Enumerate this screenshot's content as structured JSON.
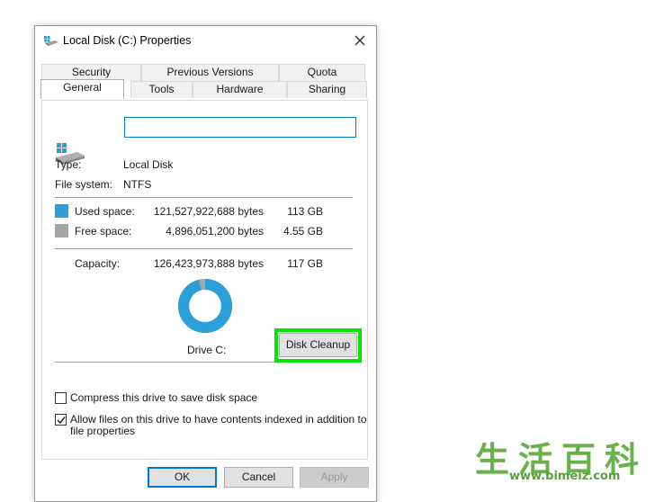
{
  "window": {
    "title": "Local Disk (C:) Properties"
  },
  "tabs": {
    "row1": [
      "Security",
      "Previous Versions",
      "Quota"
    ],
    "row2": [
      "General",
      "Tools",
      "Hardware",
      "Sharing"
    ],
    "active": "General"
  },
  "general": {
    "name_value": "",
    "type_label": "Type:",
    "type_value": "Local Disk",
    "fs_label": "File system:",
    "fs_value": "NTFS",
    "used": {
      "label": "Used space:",
      "bytes": "121,527,922,688 bytes",
      "size": "113 GB",
      "fraction": 0.961,
      "color": "#2b9fd9"
    },
    "free": {
      "label": "Free space:",
      "bytes": "4,896,051,200 bytes",
      "size": "4.55 GB",
      "fraction": 0.039,
      "color": "#a6a6a6"
    },
    "capacity": {
      "label": "Capacity:",
      "bytes": "126,423,973,888 bytes",
      "size": "117 GB"
    },
    "drive_label": "Drive C:",
    "cleanup_button": "Disk Cleanup",
    "highlight_color": "#00e600"
  },
  "options": {
    "compress": {
      "label": "Compress this drive to save disk space",
      "checked": false
    },
    "index": {
      "label_line1": "Allow files on this drive to have contents indexed in addition to",
      "label_line2": "file properties",
      "checked": true
    }
  },
  "buttons": {
    "ok": "OK",
    "cancel": "Cancel",
    "apply": "Apply"
  },
  "watermark": {
    "chars": "生活百科",
    "url": "www.bimeiz.com"
  }
}
